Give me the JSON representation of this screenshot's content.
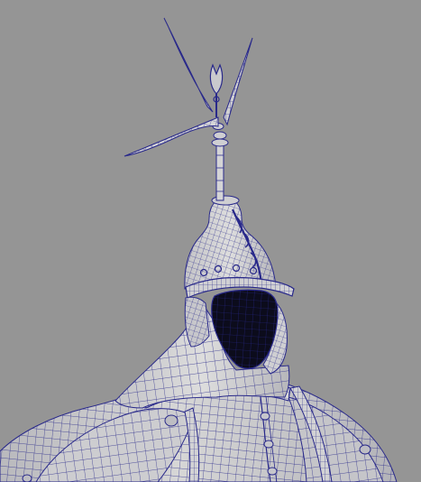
{
  "viewport": {
    "background": "#959595",
    "shaded_surface": "#d3d3d3",
    "shaded_shadow": "#a9a9ad",
    "wire_color": "#29298a",
    "inner_dark": "#0c0c1c"
  },
  "scene": {
    "model": "helmeted-armor-figure",
    "display_mode": "wireframe-on-shaded"
  }
}
